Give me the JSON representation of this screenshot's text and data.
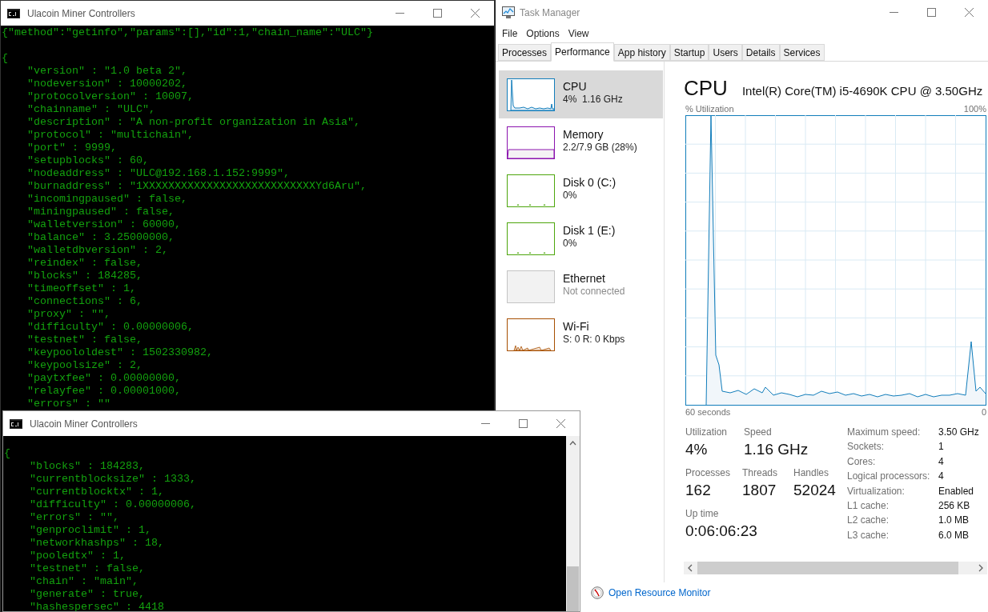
{
  "consoles": [
    {
      "title": "Ulacoin Miner Controllers",
      "command": "{\"method\":\"getinfo\",\"params\":[],\"id\":1,\"chain_name\":\"ULC\"}",
      "output": [
        "{",
        "    \"version\" : \"1.0 beta 2\",",
        "    \"nodeversion\" : 10000202,",
        "    \"protocolversion\" : 10007,",
        "    \"chainname\" : \"ULC\",",
        "    \"description\" : \"A non-profit organization in Asia\",",
        "    \"protocol\" : \"multichain\",",
        "    \"port\" : 9999,",
        "    \"setupblocks\" : 60,",
        "    \"nodeaddress\" : \"ULC@192.168.1.152:9999\",",
        "    \"burnaddress\" : \"1XXXXXXXXXXXXXXXXXXXXXXXXXXXYd6Aru\",",
        "    \"incomingpaused\" : false,",
        "    \"miningpaused\" : false,",
        "    \"walletversion\" : 60000,",
        "    \"balance\" : 3.25000000,",
        "    \"walletdbversion\" : 2,",
        "    \"reindex\" : false,",
        "    \"blocks\" : 184285,",
        "    \"timeoffset\" : 1,",
        "    \"connections\" : 6,",
        "    \"proxy\" : \"\",",
        "    \"difficulty\" : 0.00000006,",
        "    \"testnet\" : false,",
        "    \"keypoololdest\" : 1502330982,",
        "    \"keypoolsize\" : 2,",
        "    \"paytxfee\" : 0.00000000,",
        "    \"relayfee\" : 0.00001000,",
        "    \"errors\" : \"\""
      ]
    },
    {
      "title": "Ulacoin Miner Controllers",
      "output": [
        "{",
        "    \"blocks\" : 184283,",
        "    \"currentblocksize\" : 1333,",
        "    \"currentblocktx\" : 1,",
        "    \"difficulty\" : 0.00000006,",
        "    \"errors\" : \"\",",
        "    \"genproclimit\" : 1,",
        "    \"networkhashps\" : 18,",
        "    \"pooledtx\" : 1,",
        "    \"testnet\" : false,",
        "    \"chain\" : \"main\",",
        "    \"generate\" : true,",
        "    \"hashespersec\" : 4418"
      ]
    }
  ],
  "task_manager": {
    "title": "Task Manager",
    "menu": [
      "File",
      "Options",
      "View"
    ],
    "tabs": [
      {
        "label": "Processes",
        "selected": false
      },
      {
        "label": "Performance",
        "selected": true
      },
      {
        "label": "App history",
        "selected": false
      },
      {
        "label": "Startup",
        "selected": false
      },
      {
        "label": "Users",
        "selected": false
      },
      {
        "label": "Details",
        "selected": false
      },
      {
        "label": "Services",
        "selected": false
      }
    ],
    "resources": [
      {
        "kind": "cpu",
        "name": "CPU",
        "detail": "4%  1.16 GHz",
        "color": "#117dbb",
        "selected": true,
        "disabled": false
      },
      {
        "kind": "memory",
        "name": "Memory",
        "detail": "2.2/7.9 GB (28%)",
        "color": "#8b12ae",
        "selected": false,
        "disabled": false
      },
      {
        "kind": "disk",
        "name": "Disk 0 (C:)",
        "detail": "0%",
        "color": "#4da60c",
        "selected": false,
        "disabled": false
      },
      {
        "kind": "disk",
        "name": "Disk 1 (E:)",
        "detail": "0%",
        "color": "#4da60c",
        "selected": false,
        "disabled": false
      },
      {
        "kind": "network",
        "name": "Ethernet",
        "detail": "Not connected",
        "color": "#c4c4c4",
        "selected": false,
        "disabled": true
      },
      {
        "kind": "network",
        "name": "Wi-Fi",
        "detail": "S: 0 R: 0 Kbps",
        "color": "#a74f01",
        "selected": false,
        "disabled": false
      }
    ],
    "cpu": {
      "heading": "CPU",
      "model": "Intel(R) Core(TM) i5-4690K CPU @ 3.50GHz",
      "graph_label": "% Utilization",
      "graph_max": "100%",
      "time_span": "60 seconds",
      "graph_min": "0",
      "stats": [
        {
          "label": "Utilization",
          "value": "4%"
        },
        {
          "label": "Speed",
          "value": "1.16 GHz"
        }
      ],
      "counts": [
        {
          "label": "Processes",
          "value": "162"
        },
        {
          "label": "Threads",
          "value": "1807"
        },
        {
          "label": "Handles",
          "value": "52024"
        }
      ],
      "uptime": {
        "label": "Up time",
        "value": "0:06:06:23"
      },
      "specs": [
        {
          "label": "Maximum speed:",
          "value": "3.50 GHz"
        },
        {
          "label": "Sockets:",
          "value": "1"
        },
        {
          "label": "Cores:",
          "value": "4"
        },
        {
          "label": "Logical processors:",
          "value": "4"
        },
        {
          "label": "Virtualization:",
          "value": "Enabled"
        },
        {
          "label": "L1 cache:",
          "value": "256 KB"
        },
        {
          "label": "L2 cache:",
          "value": "1.0 MB"
        },
        {
          "label": "L3 cache:",
          "value": "6.0 MB"
        }
      ]
    },
    "footer_link": "Open Resource Monitor"
  }
}
